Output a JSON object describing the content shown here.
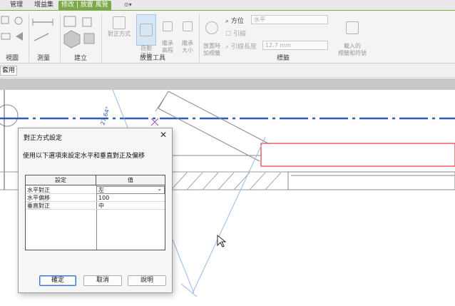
{
  "tabs": [
    "管理",
    "增益集",
    "修改 | 放置 風管"
  ],
  "tab_dropdown": "⊙▾",
  "ribbon": {
    "panels": [
      "視圖",
      "測量",
      "建立",
      "放置工具",
      "標籤"
    ],
    "tools": {
      "justify": "對正方式",
      "auto_connect": "自動\n連接",
      "inherit_elevation": "繼承\n高程",
      "inherit_size": "繼承\n大小",
      "tag_on_place": "放置時\n加標籤",
      "multi_tag": "載入的\n標籤和符號"
    },
    "options": {
      "orientation_label": "方位",
      "orientation_value": "水平",
      "leader_label": "引線",
      "leader_length_label": "引線長度",
      "leader_length_value": "12.7 mm"
    }
  },
  "propbar": {
    "apply_label": "套用"
  },
  "canvas": {
    "angle_label": "27.64°"
  },
  "dialog": {
    "title": "對正方式設定",
    "close": "✕",
    "description": "使用以下選項來設定水平和垂直對正及偏移",
    "columns": [
      "設定",
      "值"
    ],
    "rows": [
      {
        "setting": "水平對正",
        "value": "左"
      },
      {
        "setting": "水平偏移",
        "value": "100"
      },
      {
        "setting": "垂直對正",
        "value": "中"
      }
    ],
    "buttons": {
      "ok": "確定",
      "cancel": "取消",
      "help": "說明"
    }
  },
  "colors": {
    "accent_green": "#7ea94b",
    "duct_red": "#e03b3b",
    "centerline_blue": "#2f5fb8",
    "guide_blue": "#9ab8e6"
  }
}
